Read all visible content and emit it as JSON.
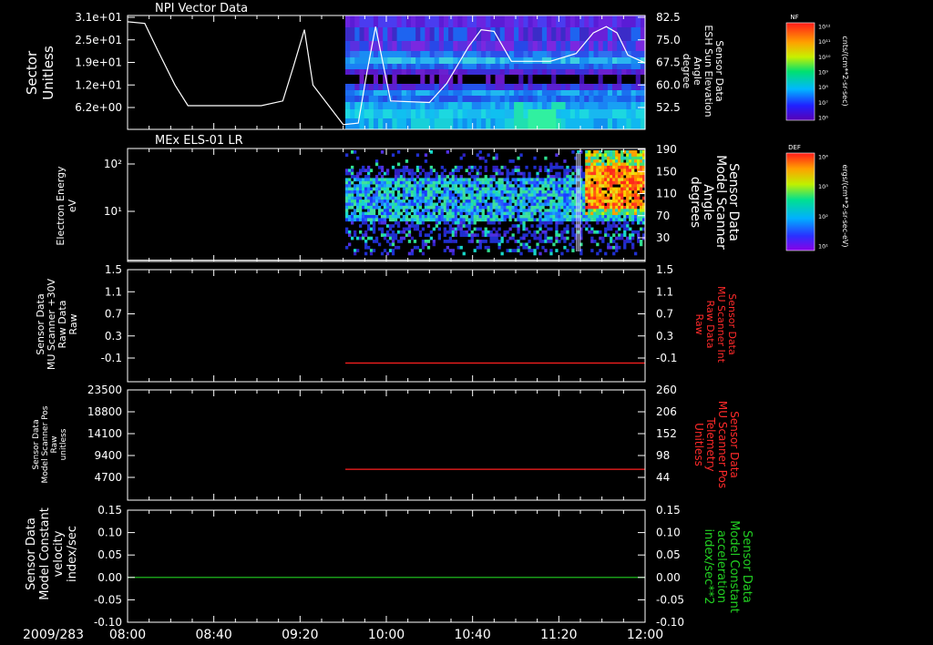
{
  "time_axis": {
    "date_label": "2009/283",
    "ticks": [
      "08:00",
      "08:40",
      "09:20",
      "10:00",
      "10:40",
      "11:20",
      "12:00"
    ],
    "start": "08:00",
    "end": "12:00",
    "data_start": "09:41"
  },
  "panels": [
    {
      "id": "npi",
      "title": "NPI Vector Data",
      "left_label": [
        "Sector",
        "Unitless"
      ],
      "left_ticks": [
        "3.1e+01",
        "2.5e+01",
        "1.9e+01",
        "1.2e+01",
        "6.2e+00"
      ],
      "right_label": [
        "Sensor Data",
        "ESH Sun Elevation",
        "Angle",
        "degree"
      ],
      "right_ticks": [
        "82.5",
        "75.0",
        "67.5",
        "60.0",
        "52.5"
      ],
      "colorbar": {
        "title": "NF",
        "unit": "cnts/(cm**2-sr-sec)",
        "ticks": [
          "10¹²",
          "10¹¹",
          "10¹⁰",
          "10⁹",
          "10⁸",
          "10⁷",
          "10⁶"
        ]
      }
    },
    {
      "id": "els",
      "title": "MEx ELS-01 LR",
      "left_label": [
        "Electron Energy",
        "eV"
      ],
      "left_ticks": [
        "10²",
        "10¹"
      ],
      "right_label": [
        "Sensor Data",
        "Model Scanner",
        "Angle",
        "degrees"
      ],
      "right_ticks": [
        "190",
        "150",
        "110",
        "70",
        "30"
      ],
      "colorbar": {
        "title": "DEF",
        "unit": "ergs/(cm**2-sr-sec-eV)",
        "ticks": [
          "10⁴",
          "10³",
          "10²",
          "10¹"
        ]
      }
    },
    {
      "id": "mu_int",
      "title": "",
      "left_label": [
        "Sensor Data",
        "MU Scanner +30V",
        "Raw Data",
        "Raw"
      ],
      "left_ticks": [
        "1.5",
        "1.1",
        "0.7",
        "0.3",
        "-0.1"
      ],
      "right_label": [
        "Sensor Data",
        "MU Scanner Int",
        "Raw Data",
        "Raw"
      ],
      "right_ticks": [
        "1.5",
        "1.1",
        "0.7",
        "0.3",
        "-0.1"
      ]
    },
    {
      "id": "mu_pos",
      "title": "",
      "left_label": [
        "Sensor Data",
        "Model Scanner Pos",
        "Raw",
        "unitless"
      ],
      "left_ticks": [
        "23500",
        "18800",
        "14100",
        "9400",
        "4700"
      ],
      "right_label": [
        "Sensor Data",
        "MU Scanner Pos",
        "Telemetry",
        "Unitless"
      ],
      "right_ticks": [
        "260",
        "206",
        "152",
        "98",
        "44"
      ]
    },
    {
      "id": "model_const",
      "title": "",
      "left_label": [
        "Sensor Data",
        "Model Constant",
        "velocity",
        "index/sec"
      ],
      "left_ticks": [
        "0.15",
        "0.10",
        "0.05",
        "0.00",
        "-0.05",
        "-0.10"
      ],
      "right_label": [
        "Sensor Data",
        "Model Constant",
        "acceleration",
        "index/sec**2"
      ],
      "right_ticks": [
        "0.15",
        "0.10",
        "0.05",
        "0.00",
        "-0.05",
        "-0.10"
      ]
    }
  ],
  "chart_data": [
    {
      "type": "heatmap",
      "panel": "npi",
      "series": [
        {
          "name": "ESH Sun Elevation Angle",
          "x": [
            "08:00",
            "08:08",
            "08:14",
            "08:22",
            "08:28",
            "09:02",
            "09:12",
            "09:17",
            "09:22",
            "09:26",
            "09:40",
            "09:47",
            "09:51",
            "09:55",
            "10:02",
            "10:20",
            "10:28",
            "10:38",
            "10:44",
            "10:50",
            "10:58",
            "11:16",
            "11:28",
            "11:36",
            "11:42",
            "11:47",
            "11:52",
            "12:00"
          ],
          "y": [
            82.0,
            81.5,
            73.0,
            62.0,
            55.5,
            55.5,
            57.0,
            68.0,
            79.5,
            62.0,
            49.5,
            50.0,
            66.0,
            80.5,
            57.0,
            56.5,
            62.5,
            74.0,
            79.5,
            79.0,
            69.5,
            69.5,
            72.0,
            78.5,
            80.5,
            78.5,
            71.5,
            69.0
          ]
        }
      ]
    },
    {
      "type": "heatmap",
      "panel": "els",
      "series": [
        {
          "name": "Model Scanner Angle",
          "x": [
            "08:00",
            "12:00"
          ],
          "y": [
            12,
            12
          ]
        }
      ]
    },
    {
      "type": "line",
      "panel": "mu_int",
      "series": [
        {
          "name": "MU Scanner Int Raw Data",
          "x": [
            "09:41",
            "12:00"
          ],
          "y": [
            0,
            0
          ]
        }
      ]
    },
    {
      "type": "line",
      "panel": "mu_pos",
      "series": [
        {
          "name": "MU Scanner Pos Telemetry",
          "x": [
            "09:41",
            "12:00"
          ],
          "y": [
            80,
            80
          ]
        }
      ]
    },
    {
      "type": "line",
      "panel": "model_const",
      "series": [
        {
          "name": "Model Constant velocity",
          "x": [
            "08:00",
            "12:00"
          ],
          "y": [
            0.0,
            0.0
          ]
        }
      ]
    }
  ],
  "colors": {
    "background": "#000000",
    "axes": "#ffffff",
    "red_trace": "#ff2020",
    "green_trace": "#22d022",
    "red_label": "#ff2a2a",
    "green_label": "#22d022"
  }
}
